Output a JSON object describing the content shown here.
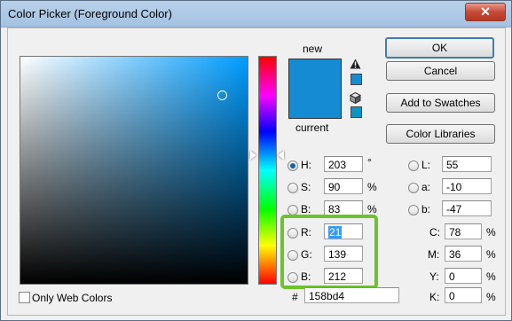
{
  "window": {
    "title": "Color Picker (Foreground Color)",
    "close_glyph": "✕"
  },
  "swatch": {
    "new_label": "new",
    "current_label": "current",
    "new_color": "#158bd4",
    "current_color": "#158bd4"
  },
  "buttons": {
    "ok": "OK",
    "cancel": "Cancel",
    "add_to_swatches": "Add to Swatches",
    "color_libraries": "Color Libraries"
  },
  "hsb": {
    "h": {
      "label": "H:",
      "value": "203",
      "unit": "°",
      "selected": true
    },
    "s": {
      "label": "S:",
      "value": "90",
      "unit": "%"
    },
    "b": {
      "label": "B:",
      "value": "83",
      "unit": "%"
    }
  },
  "rgb": {
    "r": {
      "label": "R:",
      "value": "21"
    },
    "g": {
      "label": "G:",
      "value": "139"
    },
    "b": {
      "label": "B:",
      "value": "212"
    }
  },
  "lab": {
    "l": {
      "label": "L:",
      "value": "55"
    },
    "a": {
      "label": "a:",
      "value": "-10"
    },
    "b": {
      "label": "b:",
      "value": "-47"
    }
  },
  "cmyk": {
    "c": {
      "label": "C:",
      "value": "78",
      "unit": "%"
    },
    "m": {
      "label": "M:",
      "value": "36",
      "unit": "%"
    },
    "y": {
      "label": "Y:",
      "value": "0",
      "unit": "%"
    },
    "k": {
      "label": "K:",
      "value": "0",
      "unit": "%"
    }
  },
  "hex": {
    "label": "#",
    "value": "158bd4"
  },
  "web_colors": {
    "label": "Only Web Colors",
    "checked": false
  },
  "icons": {
    "warning": "gamut-warning-icon",
    "cube": "web-safe-cube-icon"
  },
  "colors": {
    "highlight_border": "#6cc32b",
    "selection": "#3399ff"
  }
}
